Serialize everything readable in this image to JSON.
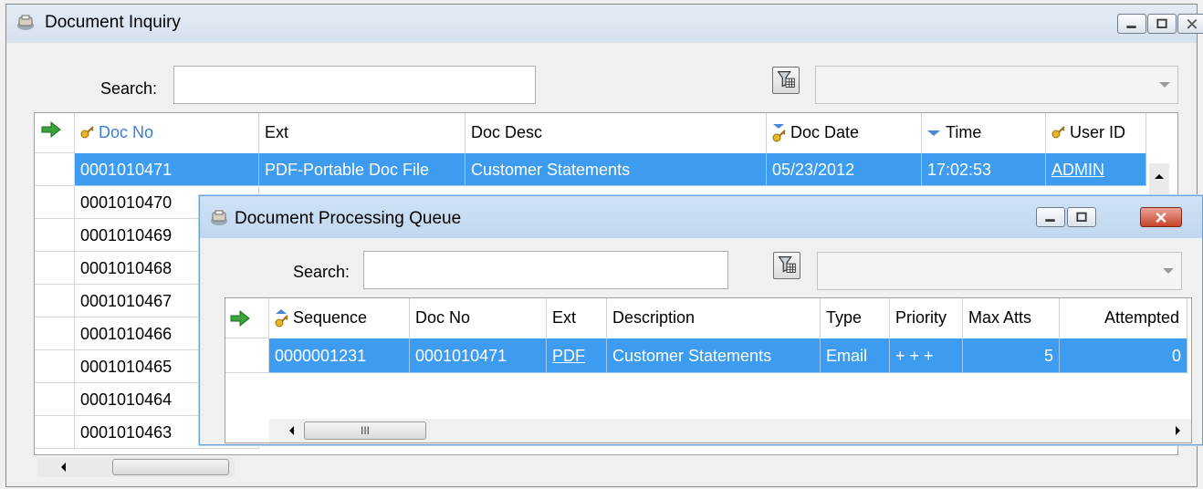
{
  "outer": {
    "title": "Document Inquiry",
    "search_label": "Search:",
    "search_value": "",
    "combo_value": "",
    "columns": [
      {
        "label": "Doc No",
        "icon": "key-icon"
      },
      {
        "label": "Ext",
        "icon": ""
      },
      {
        "label": "Doc Desc",
        "icon": ""
      },
      {
        "label": "Doc Date",
        "icon": "key-sort-desc-icon"
      },
      {
        "label": "Time",
        "icon": "sort-desc-icon"
      },
      {
        "label": "User ID",
        "icon": "key-icon"
      }
    ],
    "rows": [
      [
        "0001010471",
        "PDF-Portable Doc File",
        "Customer Statements",
        "05/23/2012",
        "17:02:53",
        "ADMIN"
      ],
      [
        "0001010470"
      ],
      [
        "0001010469"
      ],
      [
        "0001010468"
      ],
      [
        "0001010467"
      ],
      [
        "0001010466"
      ],
      [
        "0001010465"
      ],
      [
        "0001010464"
      ],
      [
        "0001010463"
      ]
    ]
  },
  "inner": {
    "title": "Document Processing Queue",
    "search_label": "Search:",
    "search_value": "",
    "combo_value": "",
    "columns": [
      {
        "label": "Sequence",
        "icon": "key-sort-asc-icon"
      },
      {
        "label": "Doc No",
        "icon": ""
      },
      {
        "label": "Ext",
        "icon": ""
      },
      {
        "label": "Description",
        "icon": ""
      },
      {
        "label": "Type",
        "icon": ""
      },
      {
        "label": "Priority",
        "icon": ""
      },
      {
        "label": "Max Atts",
        "icon": ""
      },
      {
        "label": "Attempted",
        "icon": ""
      }
    ],
    "rows": [
      [
        "0000001231",
        "0001010471",
        "PDF",
        "Customer Statements",
        "Email",
        "+ + +",
        "5",
        "0"
      ]
    ],
    "scroll_thumb_glyph": "III"
  },
  "colors": {
    "selection": "#3d9cf0",
    "sorted_header": "#3b7fd6",
    "arrow_green": "#3aa33a",
    "close_red": "#c7452c"
  }
}
